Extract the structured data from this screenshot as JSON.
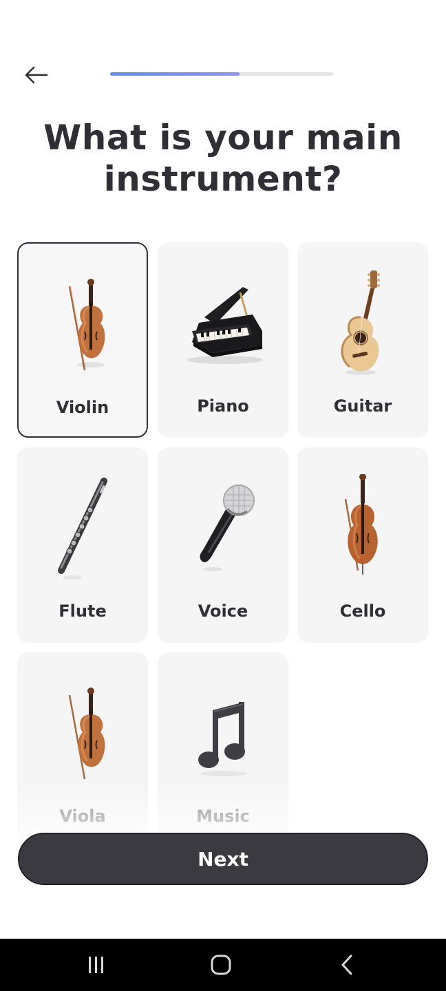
{
  "header": {
    "back_icon": "arrow-left-icon",
    "progress": 0.58,
    "progress_colors": [
      "#5b8def",
      "#8f93f2"
    ]
  },
  "title": "What is your main instrument?",
  "instruments": [
    {
      "label": "Violin",
      "icon": "violin-icon",
      "selected": true
    },
    {
      "label": "Piano",
      "icon": "grand-piano-icon",
      "selected": false
    },
    {
      "label": "Guitar",
      "icon": "acoustic-guitar-icon",
      "selected": false
    },
    {
      "label": "Flute",
      "icon": "flute-icon",
      "selected": false
    },
    {
      "label": "Voice",
      "icon": "microphone-icon",
      "selected": false
    },
    {
      "label": "Cello",
      "icon": "cello-icon",
      "selected": false
    },
    {
      "label": "Viola",
      "icon": "viola-icon",
      "selected": false
    },
    {
      "label": "Music",
      "icon": "music-note-icon",
      "selected": false
    }
  ],
  "next_label": "Next",
  "system_nav": {
    "recent_icon": "recent-apps-icon",
    "home_icon": "home-icon",
    "back_icon": "back-chevron-icon"
  },
  "colors": {
    "card_bg": "#f6f5f5",
    "selected_border": "#2f2f35",
    "button_bg": "#3a3a40",
    "text": "#2f2f35"
  }
}
